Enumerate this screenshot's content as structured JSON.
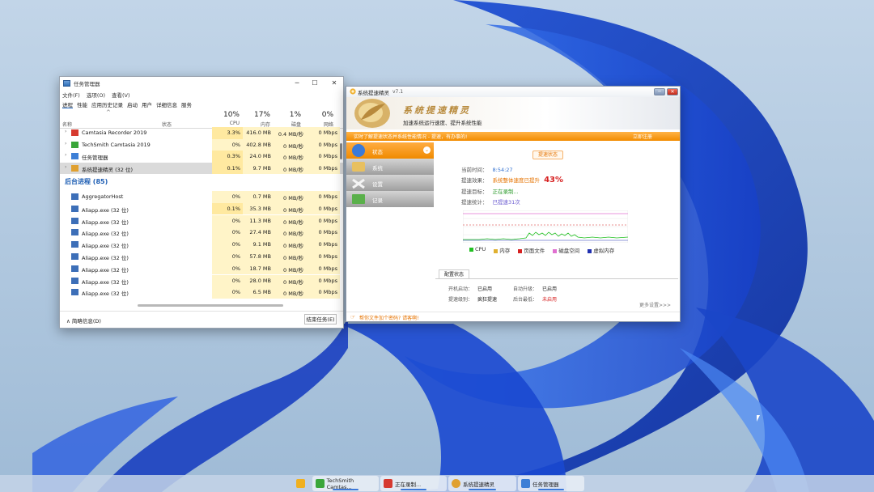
{
  "task_manager": {
    "title": "任务管理器",
    "menu": [
      "文件(F)",
      "选项(O)",
      "查看(V)"
    ],
    "tabs": [
      "进程",
      "性能",
      "应用历史记录",
      "启动",
      "用户",
      "详细信息",
      "服务"
    ],
    "active_tab": 0,
    "columns": {
      "name": "名称",
      "status": "状态",
      "cpu": {
        "percent": "10%",
        "label": "CPU"
      },
      "mem": {
        "percent": "17%",
        "label": "内存"
      },
      "disk": {
        "percent": "1%",
        "label": "磁盘"
      },
      "net": {
        "percent": "0%",
        "label": "网络"
      }
    },
    "app_rows": [
      {
        "name": "Camtasia Recorder 2019",
        "cpu": "3.3%",
        "mem": "416.0 MB",
        "disk": "0.4 MB/秒",
        "net": "0 Mbps",
        "icon_color": "#d63a2f"
      },
      {
        "name": "TechSmith Camtasia 2019",
        "cpu": "0%",
        "mem": "402.8 MB",
        "disk": "0 MB/秒",
        "net": "0 Mbps",
        "icon_color": "#3aa63a"
      },
      {
        "name": "任务管理器",
        "cpu": "0.3%",
        "mem": "24.0 MB",
        "disk": "0 MB/秒",
        "net": "0 Mbps",
        "icon_color": "#3d7fd6"
      },
      {
        "name": "系统提速精灵 (32 位)",
        "cpu": "0.1%",
        "mem": "9.7 MB",
        "disk": "0 MB/秒",
        "net": "0 Mbps",
        "icon_color": "#e0a030"
      }
    ],
    "background_group": "后台进程 (85)",
    "bg_rows": [
      {
        "name": "AggregatorHost",
        "cpu": "0%",
        "mem": "0.7 MB",
        "disk": "0 MB/秒",
        "net": "0 Mbps"
      },
      {
        "name": "Aliapp.exe (32 位)",
        "cpu": "0.1%",
        "mem": "35.3 MB",
        "disk": "0 MB/秒",
        "net": "0 Mbps"
      },
      {
        "name": "Aliapp.exe (32 位)",
        "cpu": "0%",
        "mem": "11.3 MB",
        "disk": "0 MB/秒",
        "net": "0 Mbps"
      },
      {
        "name": "Aliapp.exe (32 位)",
        "cpu": "0%",
        "mem": "27.4 MB",
        "disk": "0 MB/秒",
        "net": "0 Mbps"
      },
      {
        "name": "Aliapp.exe (32 位)",
        "cpu": "0%",
        "mem": "9.1 MB",
        "disk": "0 MB/秒",
        "net": "0 Mbps"
      },
      {
        "name": "Aliapp.exe (32 位)",
        "cpu": "0%",
        "mem": "57.8 MB",
        "disk": "0 MB/秒",
        "net": "0 Mbps"
      },
      {
        "name": "Aliapp.exe (32 位)",
        "cpu": "0%",
        "mem": "18.7 MB",
        "disk": "0 MB/秒",
        "net": "0 Mbps"
      },
      {
        "name": "Aliapp.exe (32 位)",
        "cpu": "0%",
        "mem": "28.0 MB",
        "disk": "0 MB/秒",
        "net": "0 Mbps"
      },
      {
        "name": "Aliapp.exe (32 位)",
        "cpu": "0%",
        "mem": "6.5 MB",
        "disk": "0 MB/秒",
        "net": "0 Mbps"
      }
    ],
    "less_details": "简略信息(D)",
    "end_task": "结束任务(E)"
  },
  "speedup": {
    "title": "系统提速精灵",
    "version": "v7.1",
    "brand": "系统提速精灵",
    "subtitle": "加速系统运行速度、提升系统性能",
    "notice": "实时了解提速状态并系统性能情况 - 提速，有办事的!",
    "notice_link": "立即注册",
    "nav": [
      {
        "label": "状态",
        "active": true
      },
      {
        "label": "系统",
        "active": false
      },
      {
        "label": "设置",
        "active": false
      },
      {
        "label": "记录",
        "active": false
      }
    ],
    "status_pill": "提速状态",
    "info": [
      {
        "label": "当前时间：",
        "value": "8:54:27",
        "color": "#2f6fd0"
      },
      {
        "label": "提速效果：",
        "value": "系统整体速度已提升",
        "color": "#e67300",
        "big": "43%"
      },
      {
        "label": "提速目标：",
        "value": "正在录制...",
        "color": "#2a9a2a"
      },
      {
        "label": "提速统计：",
        "value": "已提速31次",
        "color": "#6a5ad0"
      }
    ],
    "legend": [
      {
        "label": "CPU",
        "color": "#22c022"
      },
      {
        "label": "内存",
        "color": "#e0b030"
      },
      {
        "label": "页面文件",
        "color": "#d62020"
      },
      {
        "label": "磁盘空间",
        "color": "#e070d0"
      },
      {
        "label": "虚拟内存",
        "color": "#2030b0"
      }
    ],
    "config_tab": "配置状态",
    "config": [
      {
        "label": "开机启动：",
        "value": "已启用"
      },
      {
        "label": "自动升级：",
        "value": "已启用"
      },
      {
        "label": "提速级别：",
        "value": "疯狂提速"
      },
      {
        "label": "后台最低：",
        "value": "未启用",
        "color": "#d62020"
      }
    ],
    "more": "更多设置>>>",
    "footer": "帮你文件加个密码? 请客啊!"
  },
  "taskbar": [
    {
      "label": "",
      "icon_color": "#f0b020",
      "active": false
    },
    {
      "label": "TechSmith Camtas...",
      "icon_color": "#3aa63a",
      "active": true
    },
    {
      "label": "正在录制...",
      "icon_color": "#d63a2f",
      "active": true
    },
    {
      "label": "系统提速精灵",
      "icon_color": "#e0a030",
      "active": true
    },
    {
      "label": "任务管理器",
      "icon_color": "#3d7fd6",
      "active": true
    }
  ]
}
